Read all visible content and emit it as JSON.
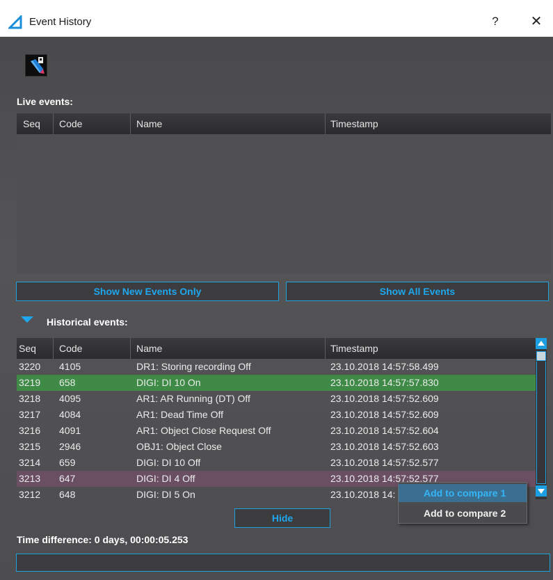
{
  "window": {
    "title": "Event History",
    "help_label": "?",
    "close_label": "✕"
  },
  "toolbar": {
    "icon": "clear-events-tool-icon"
  },
  "live": {
    "label": "Live events:",
    "columns": [
      "Seq",
      "Code",
      "Name",
      "Timestamp"
    ]
  },
  "buttons": {
    "show_new": "Show New Events Only",
    "show_all": "Show All Events",
    "hide": "Hide"
  },
  "historical": {
    "label": "Historical events:",
    "columns": [
      "Seq",
      "Code",
      "Name",
      "Timestamp"
    ],
    "rows": [
      {
        "seq": "3220",
        "code": "4105",
        "name": "DR1: Storing recording Off",
        "timestamp": "23.10.2018 14:57:58.499",
        "state": "normal"
      },
      {
        "seq": "3219",
        "code": "658",
        "name": "DIGI: DI 10 On",
        "timestamp": "23.10.2018 14:57:57.830",
        "state": "selected"
      },
      {
        "seq": "3218",
        "code": "4095",
        "name": "AR1: AR Running (DT) Off",
        "timestamp": "23.10.2018 14:57:52.609",
        "state": "normal"
      },
      {
        "seq": "3217",
        "code": "4084",
        "name": "AR1: Dead Time Off",
        "timestamp": "23.10.2018 14:57:52.609",
        "state": "normal"
      },
      {
        "seq": "3216",
        "code": "4091",
        "name": "AR1: Object Close Request Off",
        "timestamp": "23.10.2018 14:57:52.604",
        "state": "normal"
      },
      {
        "seq": "3215",
        "code": "2946",
        "name": "OBJ1: Object Close",
        "timestamp": "23.10.2018 14:57:52.603",
        "state": "normal"
      },
      {
        "seq": "3214",
        "code": "659",
        "name": "DIGI: DI 10 Off",
        "timestamp": "23.10.2018 14:57:52.577",
        "state": "normal"
      },
      {
        "seq": "3213",
        "code": "647",
        "name": "DIGI: DI 4 Off",
        "timestamp": "23.10.2018 14:57:52.577",
        "state": "highlight"
      },
      {
        "seq": "3212",
        "code": "648",
        "name": "DIGI: DI 5 On",
        "timestamp": "23.10.2018 14:",
        "state": "normal"
      }
    ]
  },
  "context_menu": {
    "items": [
      "Add to compare 1",
      "Add to compare 2"
    ]
  },
  "time_difference": "Time difference: 0 days, 00:00:05.253",
  "colors": {
    "accent": "#1ea7ee",
    "selected_row": "#3e8a46",
    "highlight_row": "#6a4f62",
    "background": "#505053"
  }
}
